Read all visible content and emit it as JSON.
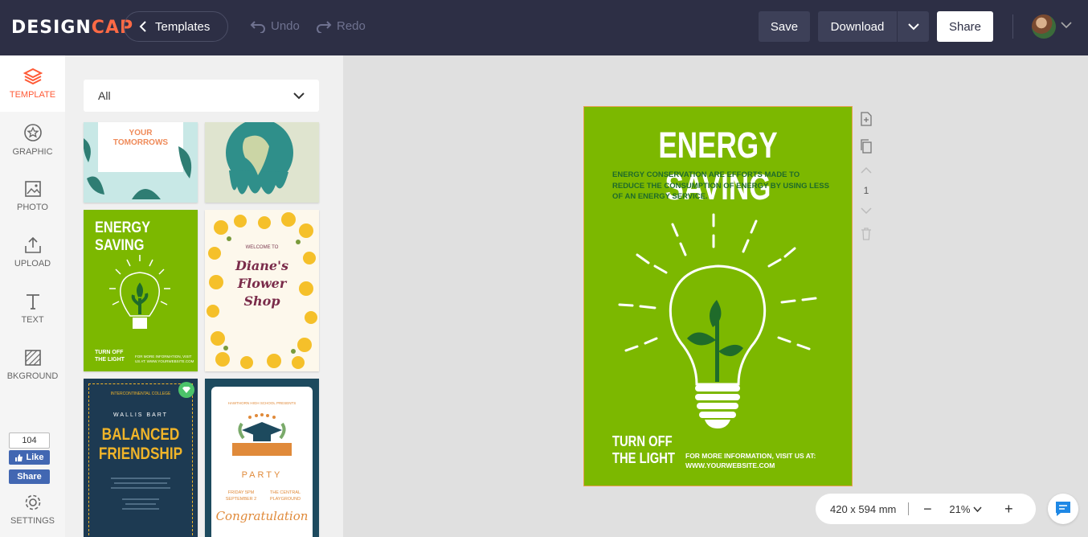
{
  "header": {
    "logo_design": "DESIGN",
    "logo_cap": "CAP",
    "templates_label": "Templates",
    "undo_label": "Undo",
    "redo_label": "Redo",
    "save_label": "Save",
    "download_label": "Download",
    "share_label": "Share"
  },
  "leftnav": {
    "items": [
      {
        "label": "TEMPLATE",
        "icon": "layers-icon"
      },
      {
        "label": "GRAPHIC",
        "icon": "star-badge-icon"
      },
      {
        "label": "PHOTO",
        "icon": "image-icon"
      },
      {
        "label": "UPLOAD",
        "icon": "upload-icon"
      },
      {
        "label": "TEXT",
        "icon": "text-icon"
      },
      {
        "label": "BKGROUND",
        "icon": "background-icon"
      },
      {
        "label": "SETTINGS",
        "icon": "gear-icon"
      }
    ],
    "fb_count": "104",
    "fb_like": "Like",
    "fb_share": "Share"
  },
  "panel": {
    "filter_value": "All",
    "thumbs": {
      "t1_text": "YOUR TOMORROWS",
      "t3_title": "ENERGY SAVING",
      "t3_footer_left": "TURN OFF THE LIGHT",
      "t3_footer_right": "FOR MORE INFORMATION, VISIT US AT: WWW.YOURWEBSITE.COM",
      "t4_welcome": "WELCOME TO",
      "t4_name": "Diane's",
      "t4_line2": "Flower",
      "t4_line3": "Shop",
      "t5_top": "INTERCONTINENTAL COLLEGE",
      "t5_name": "WALLIS BART",
      "t5_title1": "BALANCED",
      "t5_title2": "FRIENDSHIP",
      "t6_top": "HAWTHORN HIGH SCHOOL PRESENTS",
      "t6_banner": "GRADUATION",
      "t6_party": "PARTY",
      "t6_date": "FRIDAY 5PM",
      "t6_date2": "SEPTEMBER 2",
      "t6_venue": "THE CENTRAL",
      "t6_venue2": "PLAYGROUND",
      "t6_script": "Congratulation"
    }
  },
  "poster": {
    "title": "ENERGY SAVING",
    "subtitle": "ENERGY CONSERVATION ARE EFFORTS MADE TO REDUCE THE CONSUMPTION OF ENERGY BY USING LESS OF AN ENERGY SERVICE.",
    "footer_left_1": "TURN OFF",
    "footer_left_2": "THE LIGHT",
    "footer_right_1": "FOR MORE INFORMATION, VISIT US AT:",
    "footer_right_2": "WWW.YOURWEBSITE.COM",
    "bg_color": "#7cb800"
  },
  "page_controls": {
    "page_number": "1"
  },
  "zoom": {
    "size_label": "420 x 594 mm",
    "zoom_level": "21%"
  }
}
